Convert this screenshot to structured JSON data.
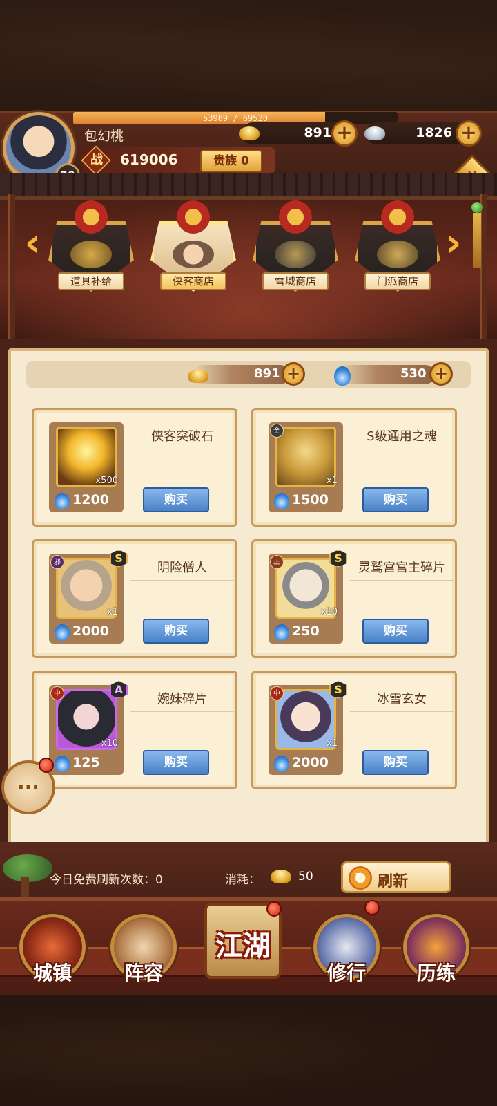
{
  "player": {
    "name": "包幻桃",
    "level": "39",
    "exp_text": "53989 / 69520",
    "exp_fraction": 0.7766,
    "power_icon": "战",
    "power": "619006",
    "noble_label": "贵族 0"
  },
  "currencies": {
    "gold": "891",
    "silver": "1826"
  },
  "shop_tabs": [
    {
      "label": "道具补给",
      "active": false
    },
    {
      "label": "侠客商店",
      "active": true
    },
    {
      "label": "雪域商店",
      "active": false
    },
    {
      "label": "门派商店",
      "active": false
    }
  ],
  "panel_currencies": {
    "gold": "891",
    "soul": "530"
  },
  "items": [
    {
      "name": "侠客突破石",
      "qty": "x500",
      "price": "1200",
      "faction": "",
      "grade": ""
    },
    {
      "name": "S级通用之魂",
      "qty": "x1",
      "price": "1500",
      "faction": "全",
      "grade": ""
    },
    {
      "name": "阴险僧人",
      "qty": "x1",
      "price": "2000",
      "faction": "邪",
      "grade": "S"
    },
    {
      "name": "灵鹫宫宫主碎片",
      "qty": "x10",
      "price": "250",
      "faction": "正",
      "grade": "S"
    },
    {
      "name": "婉妹碎片",
      "qty": "x10",
      "price": "125",
      "faction": "中",
      "grade": "A"
    },
    {
      "name": "冰雪玄女",
      "qty": "x1",
      "price": "2000",
      "faction": "中",
      "grade": "S"
    }
  ],
  "buy_label": "购买",
  "refresh": {
    "free_text": "今日免费刷新次数：",
    "free_count": "0",
    "consume_label": "消耗：",
    "consume_value": "50",
    "button_label": "刷新"
  },
  "chat_icon": "···",
  "nav": [
    {
      "label": "城镇"
    },
    {
      "label": "阵容"
    },
    {
      "label": "江湖"
    },
    {
      "label": "修行"
    },
    {
      "label": "历练"
    }
  ],
  "colors": {
    "accent_gold": "#e5a92a",
    "buy_blue": "#4a82c8",
    "panel_bg": "#f6ead2",
    "frame_red": "#4a2218"
  }
}
